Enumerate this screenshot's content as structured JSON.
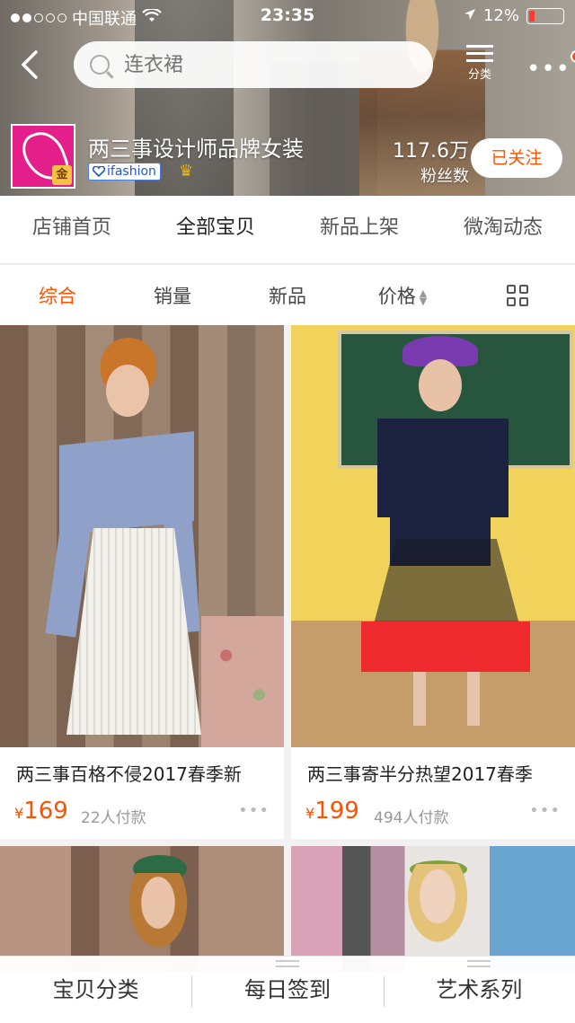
{
  "status_bar": {
    "carrier": "中国联通",
    "time": "23:35",
    "battery": "12%",
    "signal_bars_filled": 2,
    "signal_bars_total": 5,
    "battery_level": 0.12
  },
  "nav": {
    "search_placeholder": "连衣裙",
    "menu_label": "分类",
    "more_label": "•••"
  },
  "shop": {
    "name": "两三事设计师品牌女装",
    "tag": "ifashion",
    "logo_badge": "金",
    "fans_count": "117.6万",
    "fans_label": "粉丝数",
    "follow_label": "已关注"
  },
  "tabs": [
    {
      "label": "店铺首页",
      "active": false
    },
    {
      "label": "全部宝贝",
      "active": true
    },
    {
      "label": "新品上架",
      "active": false
    },
    {
      "label": "微淘动态",
      "active": false
    }
  ],
  "sorts": [
    {
      "label": "综合",
      "active": true
    },
    {
      "label": "销量",
      "active": false
    },
    {
      "label": "新品",
      "active": false
    },
    {
      "label": "价格",
      "active": false
    }
  ],
  "products": [
    {
      "title": "两三事百格不侵2017春季新",
      "currency": "¥",
      "price": "169",
      "sold": "22人付款"
    },
    {
      "title": "两三事寄半分热望2017春季",
      "currency": "¥",
      "price": "199",
      "sold": "494人付款"
    }
  ],
  "bottom_bar": [
    {
      "label": "宝贝分类"
    },
    {
      "label": "每日签到"
    },
    {
      "label": "艺术系列"
    }
  ],
  "colors": {
    "accent": "#ff5000",
    "active_text": "#222222",
    "logo_bg": "#e41e8a"
  }
}
